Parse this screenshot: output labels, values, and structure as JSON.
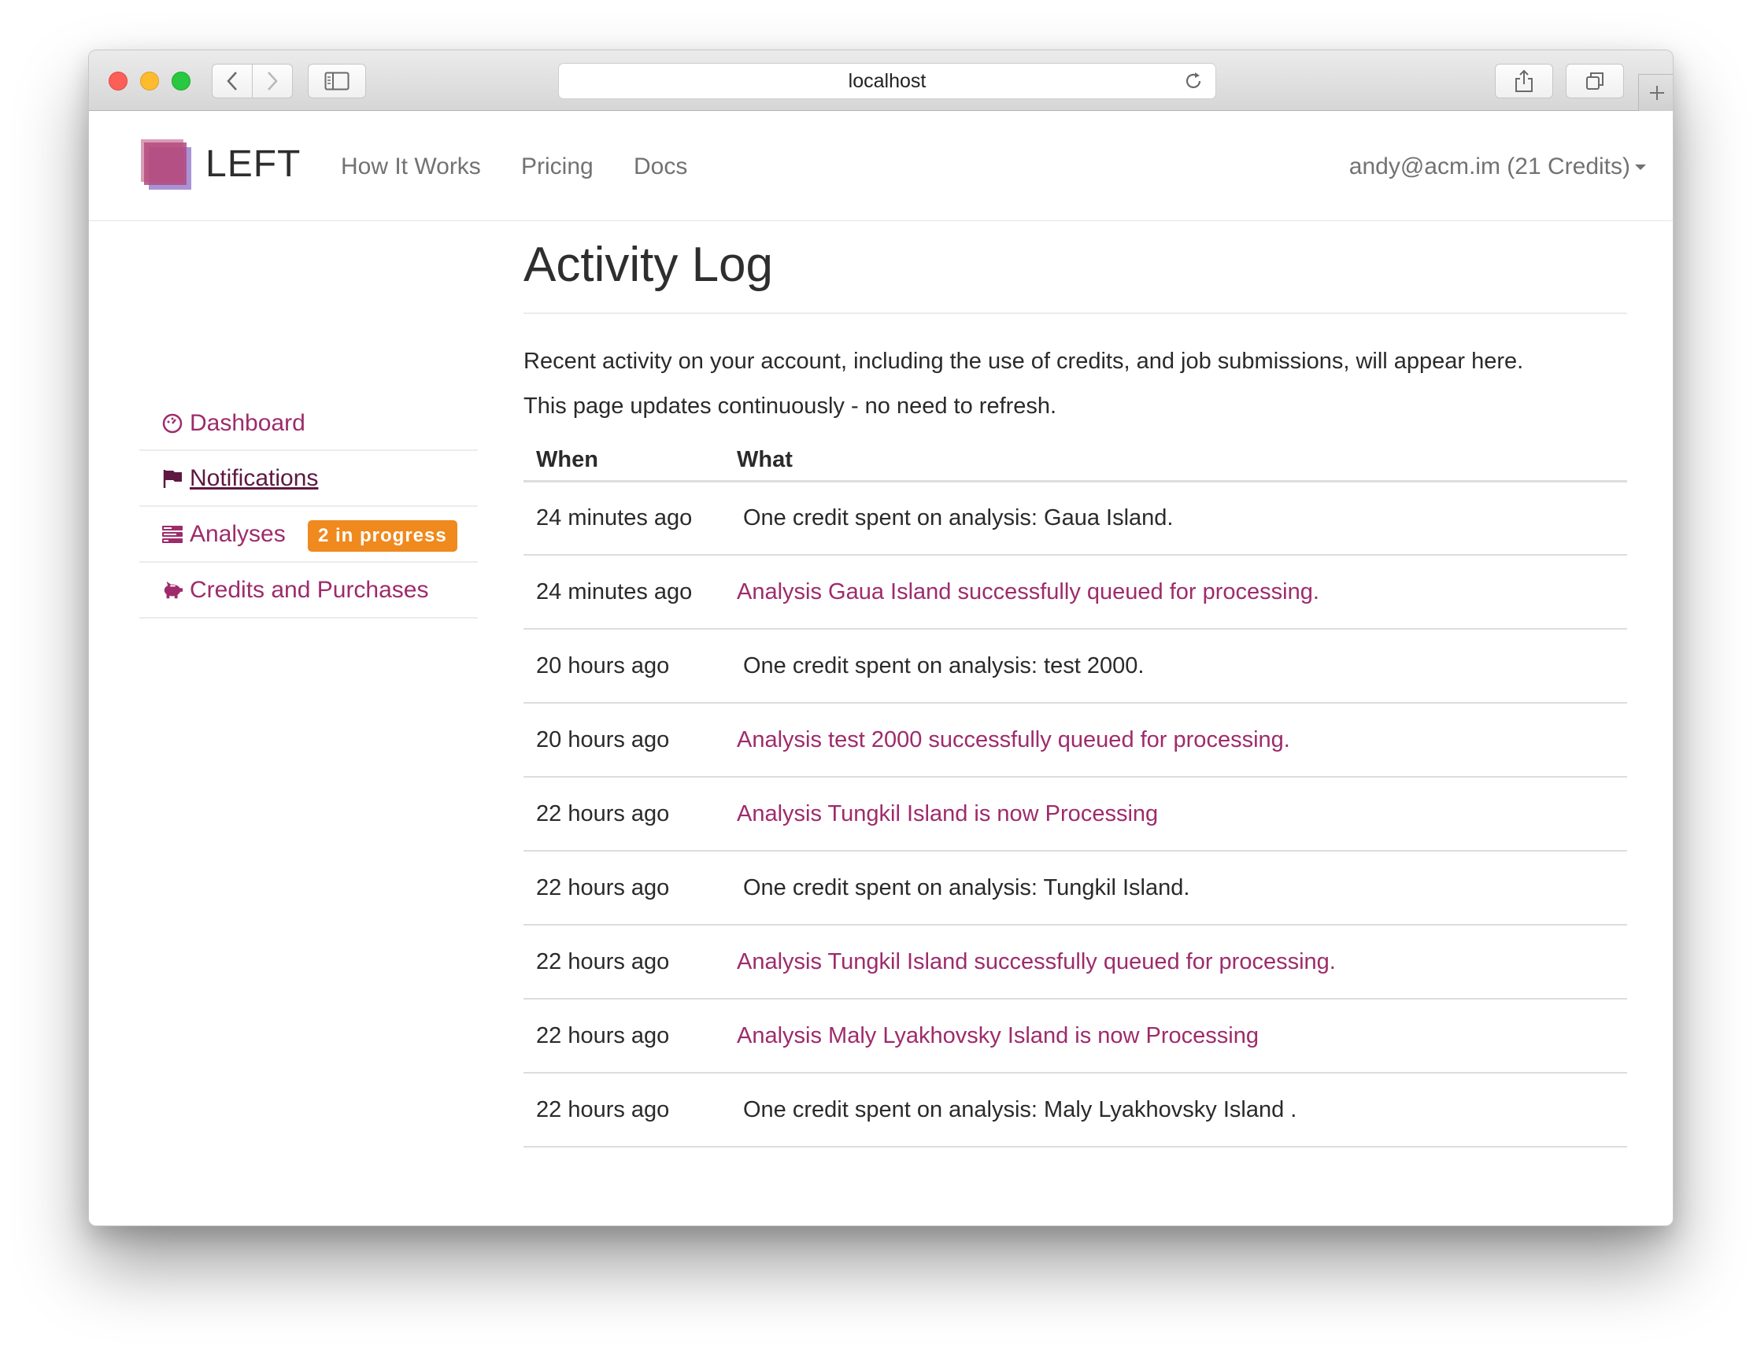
{
  "browser": {
    "address": "localhost"
  },
  "navbar": {
    "brand": "LEFT",
    "links": [
      "How It Works",
      "Pricing",
      "Docs"
    ],
    "user": "andy@acm.im (21 Credits)"
  },
  "sidebar": {
    "items": [
      {
        "label": "Dashboard",
        "icon": "dashboard-icon"
      },
      {
        "label": "Notifications",
        "icon": "flag-icon"
      },
      {
        "label": "Analyses",
        "icon": "tasks-icon",
        "badge": "2 in progress"
      },
      {
        "label": "Credits and Purchases",
        "icon": "piggy-bank-icon"
      }
    ]
  },
  "main": {
    "title": "Activity Log",
    "intro1": "Recent activity on your account, including the use of credits, and job submissions, will appear here.",
    "intro2": "This page updates continuously - no need to refresh.",
    "table": {
      "headers": [
        "When",
        "What"
      ],
      "rows": [
        {
          "when": "24 minutes ago",
          "what": "One credit spent on analysis: Gaua Island."
        },
        {
          "when": "24 minutes ago",
          "what": "Analysis Gaua Island successfully queued for processing."
        },
        {
          "when": "20 hours ago",
          "what": "One credit spent on analysis: test 2000."
        },
        {
          "when": "20 hours ago",
          "what": "Analysis test 2000 successfully queued for processing."
        },
        {
          "when": "22 hours ago",
          "what": "Analysis Tungkil Island is now Processing"
        },
        {
          "when": "22 hours ago",
          "what": "One credit spent on analysis: Tungkil Island."
        },
        {
          "when": "22 hours ago",
          "what": "Analysis Tungkil Island successfully queued for processing."
        },
        {
          "when": "22 hours ago",
          "what": "Analysis Maly Lyakhovsky Island is now Processing"
        },
        {
          "when": "22 hours ago",
          "what": "One credit spent on analysis: Maly Lyakhovsky Island ."
        }
      ]
    }
  },
  "colors": {
    "accent": "#9e2b6b",
    "badge": "#f0891e",
    "logo": "#b04a83"
  }
}
